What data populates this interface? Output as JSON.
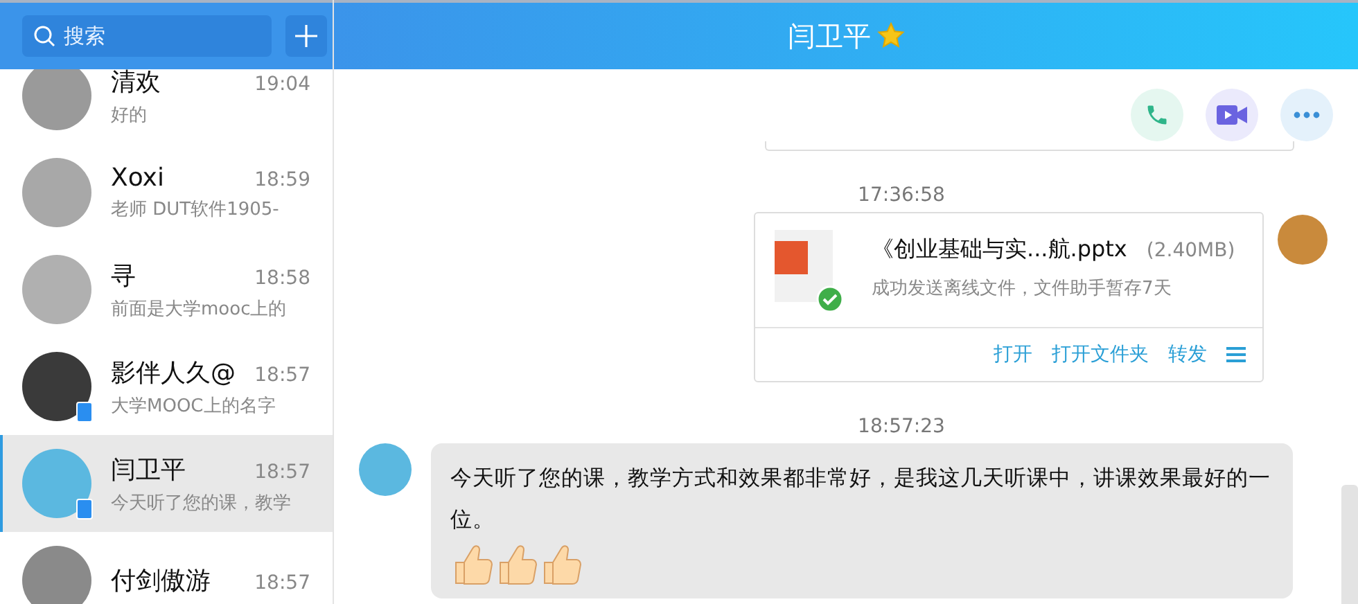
{
  "sidebar": {
    "search": {
      "placeholder": "搜索"
    },
    "contacts": [
      {
        "name": "清欢",
        "time": "19:04",
        "preview": "好的",
        "selected": false,
        "mobile": false,
        "color": "#9a9a9a"
      },
      {
        "name": "Xoxi",
        "time": "18:59",
        "preview": "老师 DUT软件1905-",
        "selected": false,
        "mobile": false,
        "color": "#a8a8a8"
      },
      {
        "name": "寻",
        "time": "18:58",
        "preview": "前面是大学mooc上的",
        "selected": false,
        "mobile": false,
        "color": "#b0b0b0"
      },
      {
        "name": "影伴人久@",
        "time": "18:57",
        "preview": "大学MOOC上的名字",
        "selected": false,
        "mobile": true,
        "color": "#3a3a3a"
      },
      {
        "name": "闫卫平",
        "time": "18:57",
        "preview": "今天听了您的课，教学",
        "selected": true,
        "mobile": true,
        "color": "#5bb8e0"
      },
      {
        "name": "付剑傲游",
        "time": "18:57",
        "selected": false,
        "mobile": false,
        "color": "#8a8a8a"
      }
    ]
  },
  "chat": {
    "title": "闫卫平",
    "messages": [
      {
        "kind": "file",
        "time": "17:36:58",
        "file_name": "《创业基础与实...航.pptx",
        "size": "(2.40MB)",
        "status": "成功发送离线文件，文件助手暂存7天",
        "actions": [
          "打开",
          "打开文件夹",
          "转发"
        ]
      },
      {
        "kind": "text",
        "time": "18:57:23",
        "text": "今天听了您的课，教学方式和效果都非常好，是我这几天听课中，讲课效果最好的一位。"
      }
    ]
  }
}
